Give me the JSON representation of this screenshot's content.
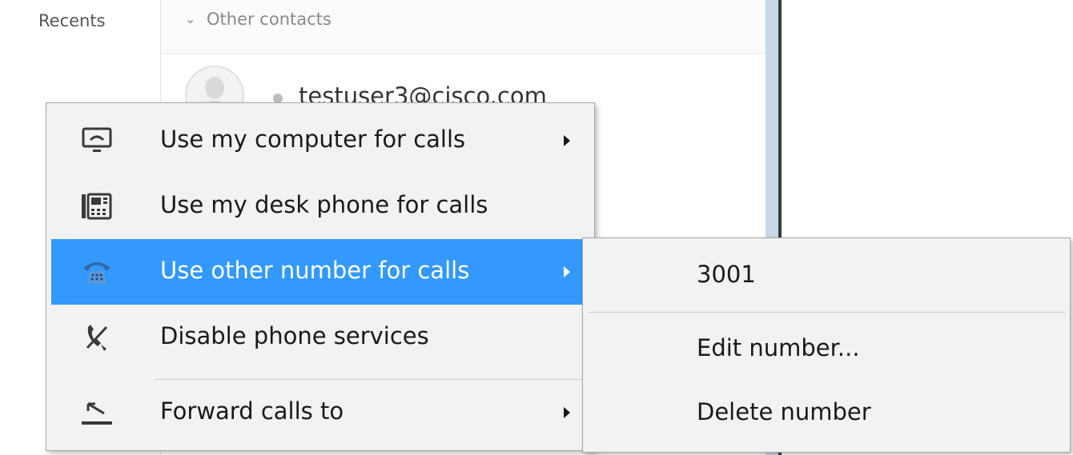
{
  "background": {
    "recents_label": "Recents",
    "group_label": "Other contacts",
    "contact_email": "testuser3@cisco.com"
  },
  "menu": {
    "items": [
      {
        "label": "Use my computer for calls",
        "icon": "computer-monitor-icon",
        "has_submenu": true,
        "highlighted": false
      },
      {
        "label": "Use my desk phone for calls",
        "icon": "desk-phone-icon",
        "has_submenu": false,
        "highlighted": false
      },
      {
        "label": "Use other number for calls",
        "icon": "telephone-icon",
        "has_submenu": true,
        "highlighted": true
      },
      {
        "label": "Disable phone services",
        "icon": "phone-disabled-icon",
        "has_submenu": false,
        "highlighted": false
      },
      {
        "label": "Forward calls to",
        "icon": "call-forward-icon",
        "has_submenu": true,
        "highlighted": false
      }
    ]
  },
  "submenu": {
    "items": [
      {
        "label": "3001"
      },
      {
        "label": "Edit number..."
      },
      {
        "label": "Delete number"
      }
    ]
  },
  "colors": {
    "highlight": "#3399ff",
    "menu_background": "#f2f2f2",
    "splitter": "#c9d8e8"
  }
}
